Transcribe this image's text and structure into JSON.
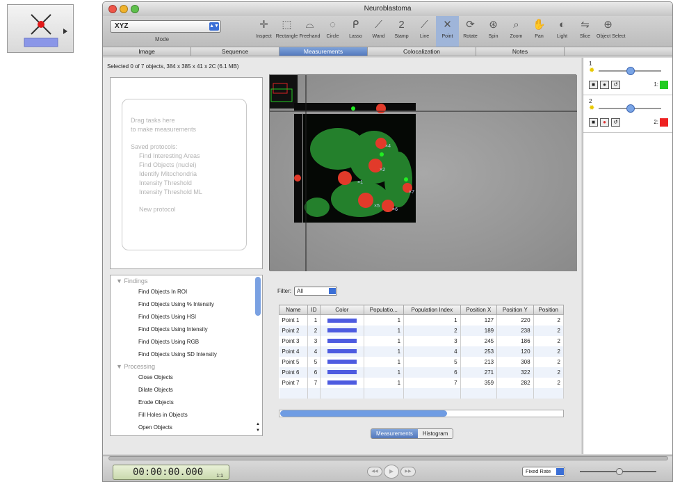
{
  "window": {
    "title": "Neuroblastoma"
  },
  "toolbar": {
    "mode_value": "XYZ",
    "mode_label": "Mode",
    "tools": [
      {
        "icon": "inspect-icon",
        "label": "Inspect",
        "glyph": "✛"
      },
      {
        "icon": "rectangle-icon",
        "label": "Rectangle",
        "glyph": "⬚"
      },
      {
        "icon": "freehand-icon",
        "label": "Freehand",
        "glyph": "⌓"
      },
      {
        "icon": "circle-icon",
        "label": "Circle",
        "glyph": "◌"
      },
      {
        "icon": "lasso-icon",
        "label": "Lasso",
        "glyph": "ᑭ"
      },
      {
        "icon": "wand-icon",
        "label": "Wand",
        "glyph": "⟋"
      },
      {
        "icon": "stamp-icon",
        "label": "Stamp",
        "glyph": "2"
      },
      {
        "icon": "line-icon",
        "label": "Line",
        "glyph": "⟋"
      },
      {
        "icon": "point-icon",
        "label": "Point",
        "glyph": "✕"
      },
      {
        "icon": "rotate-icon",
        "label": "Rotate",
        "glyph": "⟳"
      },
      {
        "icon": "spin-icon",
        "label": "Spin",
        "glyph": "⊛"
      },
      {
        "icon": "zoom-icon",
        "label": "Zoom",
        "glyph": "⌕"
      },
      {
        "icon": "pan-icon",
        "label": "Pan",
        "glyph": "✋"
      },
      {
        "icon": "light-icon",
        "label": "Light",
        "glyph": "◐"
      },
      {
        "icon": "slice-icon",
        "label": "Slice",
        "glyph": "⇋"
      },
      {
        "icon": "object-select-icon",
        "label": "Object Select",
        "glyph": "⊕"
      }
    ]
  },
  "tabs": [
    {
      "label": "Image"
    },
    {
      "label": "Sequence"
    },
    {
      "label": "Measurements"
    },
    {
      "label": "Colocalization"
    },
    {
      "label": "Notes"
    }
  ],
  "status": "Selected 0 of 7 objects, 384 x 385 x 41 x 2C (6.1 MB)",
  "dropzone": {
    "line1": "Drag tasks here",
    "line2": "to make measurements",
    "saved_label": "Saved protocols:",
    "protocols": [
      "Find Interesting Areas",
      "Find Objects (nuclei)",
      "Identify Mitochondria",
      "Intensity Threshold",
      "Intensity Threshold ML"
    ],
    "new_label": "New protocol"
  },
  "tasks": {
    "group1": "Findings",
    "group1_items": [
      "Find Objects In ROI",
      "Find Objects Using % Intensity",
      "Find Objects Using HSI",
      "Find Objects Using Intensity",
      "Find Objects Using RGB",
      "Find Objects Using SD Intensity"
    ],
    "group2": "Processing",
    "group2_items": [
      "Close Objects",
      "Dilate Objects",
      "Erode Objects",
      "Fill Holes in Objects",
      "Open Objects"
    ]
  },
  "measurements": {
    "filter_label": "Filter:",
    "filter_value": "All",
    "columns": [
      "Name",
      "ID",
      "Color",
      "Populatio...",
      "Population Index",
      "Position X",
      "Position Y",
      "Position"
    ],
    "rows": [
      {
        "name": "Point 1",
        "id": "1",
        "pop": "1",
        "idx": "1",
        "x": "127",
        "y": "220",
        "z": "2"
      },
      {
        "name": "Point 2",
        "id": "2",
        "pop": "1",
        "idx": "2",
        "x": "189",
        "y": "238",
        "z": "2"
      },
      {
        "name": "Point 3",
        "id": "3",
        "pop": "1",
        "idx": "3",
        "x": "245",
        "y": "186",
        "z": "2"
      },
      {
        "name": "Point 4",
        "id": "4",
        "pop": "1",
        "idx": "4",
        "x": "253",
        "y": "120",
        "z": "2"
      },
      {
        "name": "Point 5",
        "id": "5",
        "pop": "1",
        "idx": "5",
        "x": "213",
        "y": "308",
        "z": "2"
      },
      {
        "name": "Point 6",
        "id": "6",
        "pop": "1",
        "idx": "6",
        "x": "271",
        "y": "322",
        "z": "2"
      },
      {
        "name": "Point 7",
        "id": "7",
        "pop": "1",
        "idx": "7",
        "x": "359",
        "y": "282",
        "z": "2"
      }
    ],
    "swatch_color": "#4d5be0",
    "view_tabs": [
      "Measurements",
      "Histogram"
    ]
  },
  "channels": [
    {
      "num": "1",
      "label": "1:",
      "color": "#22cc22"
    },
    {
      "num": "2",
      "label": "2:",
      "color": "#ee2222"
    }
  ],
  "transport": {
    "timecode": "00:00:00.000",
    "frame": "1:1",
    "rate": "Fixed Rate"
  }
}
